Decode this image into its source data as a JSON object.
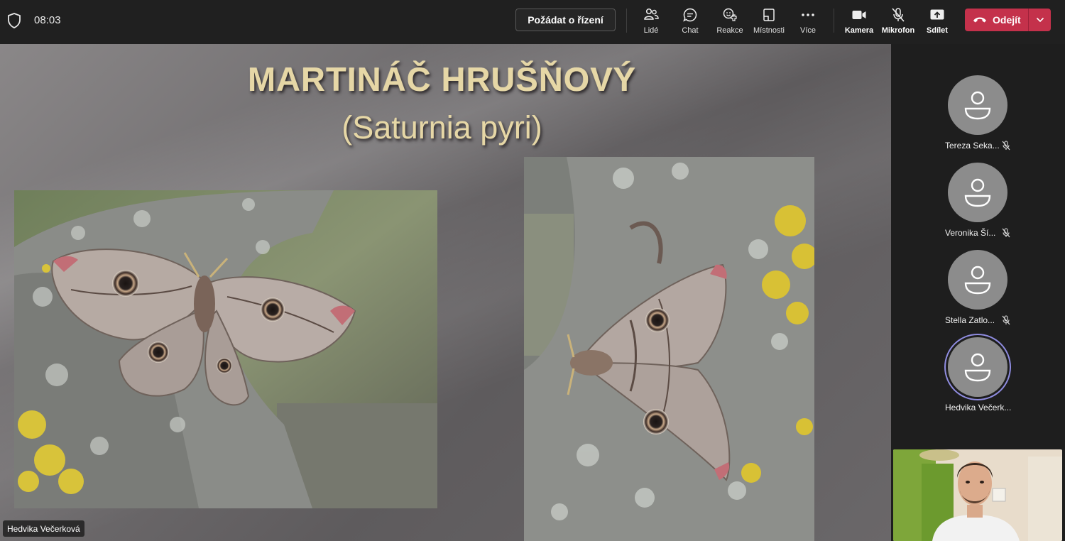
{
  "meeting": {
    "timer": "08:03",
    "request_control_label": "Požádat o řízení",
    "leave_label": "Odejít"
  },
  "toolbar": [
    {
      "name": "people",
      "label": "Lidé",
      "icon": "people-icon"
    },
    {
      "name": "chat",
      "label": "Chat",
      "icon": "chat-icon"
    },
    {
      "name": "reactions",
      "label": "Reakce",
      "icon": "reactions-icon"
    },
    {
      "name": "rooms",
      "label": "Místnosti",
      "icon": "rooms-icon"
    },
    {
      "name": "more",
      "label": "Více",
      "icon": "more-icon"
    },
    {
      "name": "camera",
      "label": "Kamera",
      "icon": "camera-icon"
    },
    {
      "name": "microphone",
      "label": "Mikrofon",
      "icon": "mic-off-icon"
    },
    {
      "name": "share",
      "label": "Sdílet",
      "icon": "share-icon"
    }
  ],
  "slide": {
    "title": "MARTINÁČ HRUŠŇOVÝ",
    "subtitle": "(Saturnia pyri)"
  },
  "presenter": {
    "name": "Hedvika Večerková"
  },
  "participants": [
    {
      "name": "Tereza Seka...",
      "muted": true,
      "speaking": false
    },
    {
      "name": "Veronika Ší...",
      "muted": true,
      "speaking": false
    },
    {
      "name": "Stella Zatlo...",
      "muted": true,
      "speaking": false
    },
    {
      "name": "Hedvika Večerk...",
      "muted": false,
      "speaking": true
    }
  ],
  "colors": {
    "leave_button": "#c4314b",
    "speaking_ring": "#8f8ce0",
    "slide_title": "#e6d7a6"
  }
}
